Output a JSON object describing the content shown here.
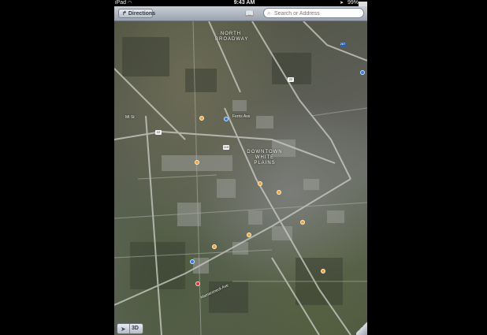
{
  "status_bar": {
    "carrier": "iPad",
    "wifi_icon": "wifi-icon",
    "time": "9:43 AM",
    "location_icon": "location-arrow-icon",
    "battery_percent": "99%"
  },
  "toolbar": {
    "directions_label": "Directions",
    "bookmarks_icon": "book-icon",
    "search_placeholder": "Search or Address"
  },
  "map": {
    "neighborhood_labels": [
      {
        "text": "NORTH\nBROADWAY"
      },
      {
        "text": "DOWNTOWN\nWHITE\nPLAINS"
      }
    ],
    "street_labels": [
      "Mt St",
      "Ferris Ave",
      "Mamaroneck Ave"
    ],
    "route_shields": [
      "287",
      "22",
      "119",
      "22"
    ]
  },
  "controls": {
    "tracking_icon": "location-arrow-icon",
    "mode_3d_label": "3D"
  }
}
